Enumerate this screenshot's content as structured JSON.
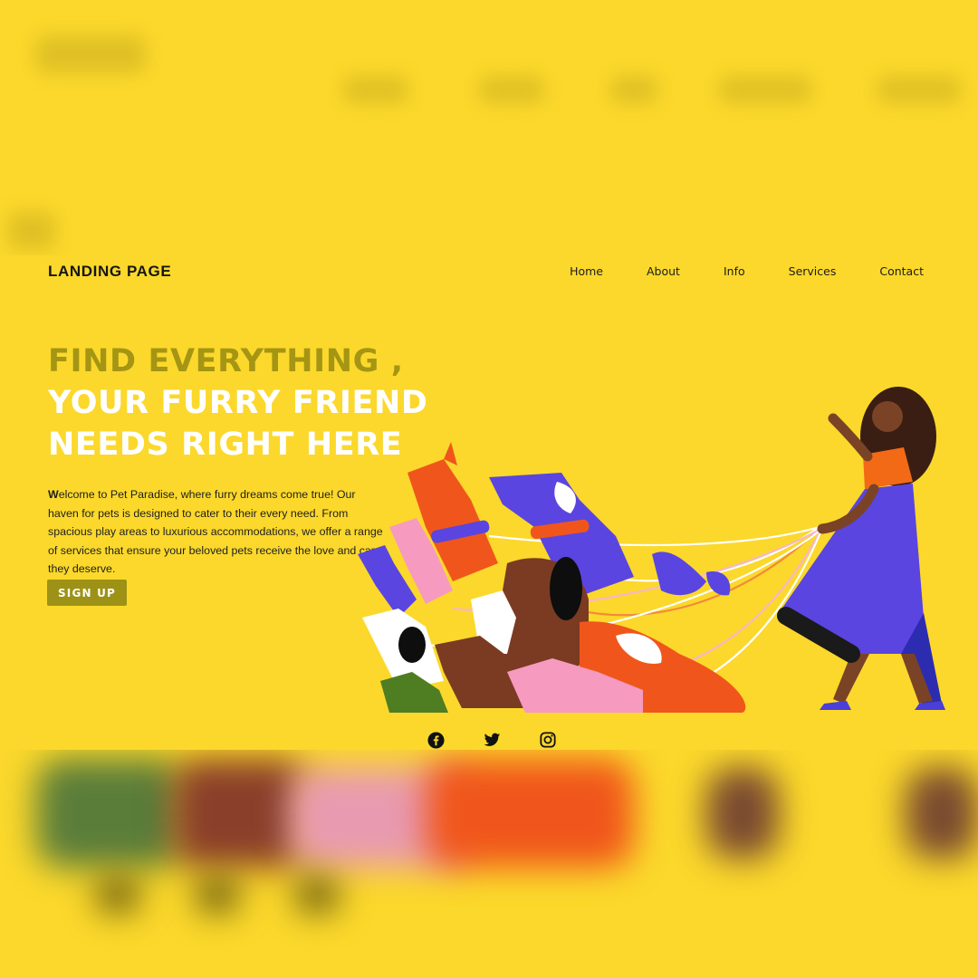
{
  "header": {
    "logo": "LANDING PAGE",
    "nav": [
      "Home",
      "About",
      "Info",
      "Services",
      "Contact"
    ]
  },
  "hero": {
    "line1": "FIND EVERYTHING ,",
    "line2": "YOUR FURRY FRIEND",
    "line3": "NEEDS RIGHT HERE",
    "description_first_letter": "W",
    "description": "elcome to Pet Paradise, where furry dreams come true! Our haven for pets is designed to cater to their every need. From spacious play areas to luxurious accommodations, we offer a range of services that ensure your beloved pets receive the love and care they deserve.",
    "signup_label": "SIGN UP"
  },
  "socials": [
    {
      "icon": "facebook-icon"
    },
    {
      "icon": "twitter-icon"
    },
    {
      "icon": "instagram-icon"
    }
  ],
  "colors": {
    "background": "#fbd82b",
    "accent_olive": "#a59514",
    "button": "#9d9216",
    "text_dark": "#1c1c1c"
  }
}
